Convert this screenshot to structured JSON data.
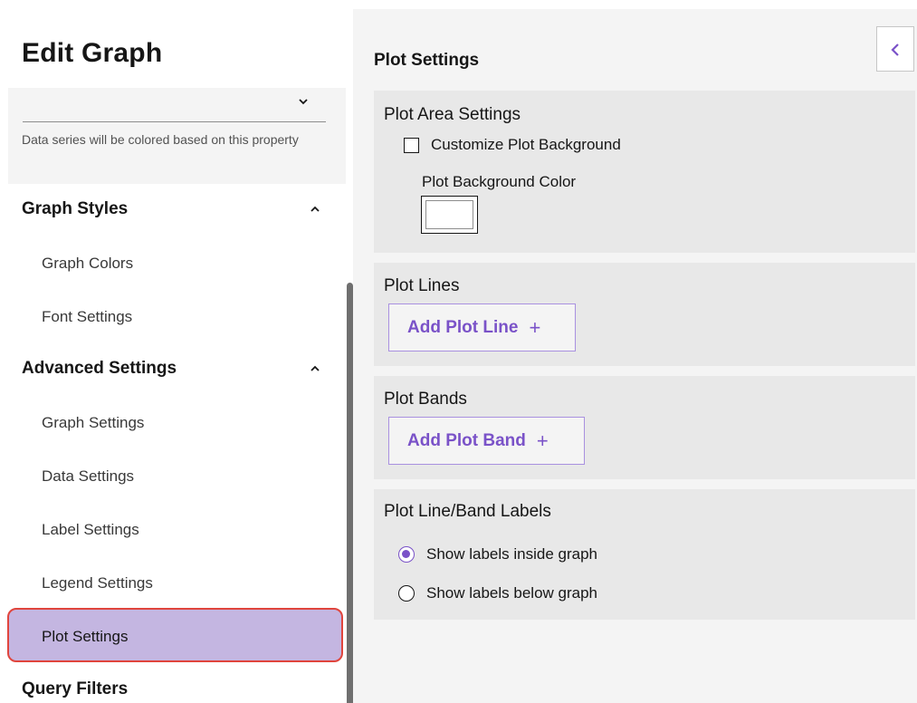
{
  "left_panel": {
    "title": "Edit Graph",
    "color_property": {
      "value": "",
      "helper_text": "Data series will be colored based on this property"
    },
    "sections": {
      "graph_styles": {
        "label": "Graph Styles",
        "items": [
          "Graph Colors",
          "Font Settings"
        ]
      },
      "advanced_settings": {
        "label": "Advanced Settings",
        "items": [
          "Graph Settings",
          "Data Settings",
          "Label Settings",
          "Legend Settings",
          "Plot Settings"
        ],
        "selected": "Plot Settings"
      },
      "query_filters": {
        "label": "Query Filters"
      }
    }
  },
  "right_panel": {
    "title": "Plot Settings",
    "collapse_icon": "chevron-left-icon",
    "plot_area": {
      "title": "Plot Area Settings",
      "customize_label": "Customize Plot Background",
      "customize_checked": false,
      "bg_color_label": "Plot Background Color",
      "bg_color": "#ffffff"
    },
    "plot_lines": {
      "title": "Plot Lines",
      "add_label": "Add Plot Line"
    },
    "plot_bands": {
      "title": "Plot Bands",
      "add_label": "Add Plot Band"
    },
    "labels": {
      "title": "Plot Line/Band Labels",
      "options": [
        "Show labels inside graph",
        "Show labels below graph"
      ],
      "selected": "Show labels inside graph"
    }
  },
  "colors": {
    "accent": "#7a52c8",
    "selected_bg": "#c4b6e1",
    "highlight_border": "#e0453d"
  }
}
